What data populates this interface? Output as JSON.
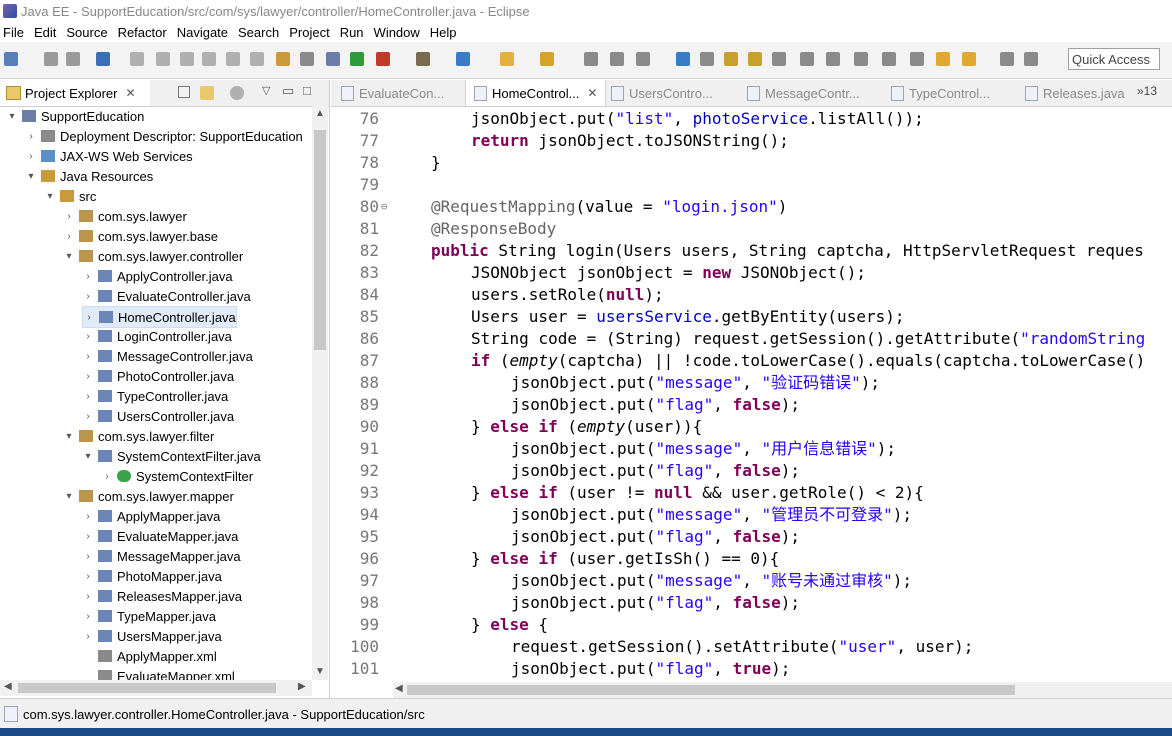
{
  "window": {
    "title": "Java EE - SupportEducation/src/com/sys/lawyer/controller/HomeController.java - Eclipse"
  },
  "menu": [
    "File",
    "Edit",
    "Source",
    "Refactor",
    "Navigate",
    "Search",
    "Project",
    "Run",
    "Window",
    "Help"
  ],
  "toolbar": {
    "quick_access": "Quick Access"
  },
  "project_explorer": {
    "tab_label": "Project Explorer",
    "tree": [
      {
        "label": "SupportEducation",
        "depth": 0,
        "arrow": "▾",
        "icon": "project-icon",
        "color": "#6a7fa8"
      },
      {
        "label": "Deployment Descriptor: SupportEducation",
        "depth": 1,
        "arrow": "›",
        "icon": "descriptor-icon",
        "color": "#8a8a8a"
      },
      {
        "label": "JAX-WS Web Services",
        "depth": 1,
        "arrow": "›",
        "icon": "webservice-icon",
        "color": "#5a8fc8"
      },
      {
        "label": "Java Resources",
        "depth": 1,
        "arrow": "▾",
        "icon": "resources-icon",
        "color": "#c89a3a"
      },
      {
        "label": "src",
        "depth": 2,
        "arrow": "▾",
        "icon": "source-folder-icon",
        "color": "#c89a3a"
      },
      {
        "label": "com.sys.lawyer",
        "depth": 3,
        "arrow": "›",
        "icon": "package-icon",
        "color": "#b9964a"
      },
      {
        "label": "com.sys.lawyer.base",
        "depth": 3,
        "arrow": "›",
        "icon": "package-icon",
        "color": "#b9964a"
      },
      {
        "label": "com.sys.lawyer.controller",
        "depth": 3,
        "arrow": "▾",
        "icon": "package-icon",
        "color": "#b9964a"
      },
      {
        "label": "ApplyController.java",
        "depth": 4,
        "arrow": "›",
        "icon": "java-file-icon",
        "color": "#6a86b8"
      },
      {
        "label": "EvaluateController.java",
        "depth": 4,
        "arrow": "›",
        "icon": "java-file-icon",
        "color": "#6a86b8"
      },
      {
        "label": "HomeController.java",
        "depth": 4,
        "arrow": "›",
        "icon": "java-file-icon",
        "color": "#6a86b8",
        "selected": true
      },
      {
        "label": "LoginController.java",
        "depth": 4,
        "arrow": "›",
        "icon": "java-file-icon",
        "color": "#6a86b8"
      },
      {
        "label": "MessageController.java",
        "depth": 4,
        "arrow": "›",
        "icon": "java-file-icon",
        "color": "#6a86b8"
      },
      {
        "label": "PhotoController.java",
        "depth": 4,
        "arrow": "›",
        "icon": "java-file-icon",
        "color": "#6a86b8"
      },
      {
        "label": "TypeController.java",
        "depth": 4,
        "arrow": "›",
        "icon": "java-file-icon",
        "color": "#6a86b8"
      },
      {
        "label": "UsersController.java",
        "depth": 4,
        "arrow": "›",
        "icon": "java-file-icon",
        "color": "#6a86b8"
      },
      {
        "label": "com.sys.lawyer.filter",
        "depth": 3,
        "arrow": "▾",
        "icon": "package-icon",
        "color": "#b9964a"
      },
      {
        "label": "SystemContextFilter.java",
        "depth": 4,
        "arrow": "▾",
        "icon": "java-file-icon",
        "color": "#6a86b8"
      },
      {
        "label": "SystemContextFilter",
        "depth": 5,
        "arrow": "›",
        "icon": "class-icon",
        "color": "#3aa34a"
      },
      {
        "label": "com.sys.lawyer.mapper",
        "depth": 3,
        "arrow": "▾",
        "icon": "package-icon",
        "color": "#b9964a"
      },
      {
        "label": "ApplyMapper.java",
        "depth": 4,
        "arrow": "›",
        "icon": "java-file-icon",
        "color": "#6a86b8"
      },
      {
        "label": "EvaluateMapper.java",
        "depth": 4,
        "arrow": "›",
        "icon": "java-file-icon",
        "color": "#6a86b8"
      },
      {
        "label": "MessageMapper.java",
        "depth": 4,
        "arrow": "›",
        "icon": "java-file-icon",
        "color": "#6a86b8"
      },
      {
        "label": "PhotoMapper.java",
        "depth": 4,
        "arrow": "›",
        "icon": "java-file-icon",
        "color": "#6a86b8"
      },
      {
        "label": "ReleasesMapper.java",
        "depth": 4,
        "arrow": "›",
        "icon": "java-file-icon",
        "color": "#6a86b8"
      },
      {
        "label": "TypeMapper.java",
        "depth": 4,
        "arrow": "›",
        "icon": "java-file-icon",
        "color": "#6a86b8"
      },
      {
        "label": "UsersMapper.java",
        "depth": 4,
        "arrow": "›",
        "icon": "java-file-icon",
        "color": "#6a86b8"
      },
      {
        "label": "ApplyMapper.xml",
        "depth": 4,
        "arrow": "",
        "icon": "xml-file-icon",
        "color": "#8a8a8a"
      },
      {
        "label": "EvaluateMapper.xml",
        "depth": 4,
        "arrow": "",
        "icon": "xml-file-icon",
        "color": "#8a8a8a"
      }
    ]
  },
  "editor": {
    "tabs": [
      {
        "label": "EvaluateCon...",
        "active": false
      },
      {
        "label": "HomeControl...",
        "active": true
      },
      {
        "label": "UsersContro...",
        "active": false
      },
      {
        "label": "MessageContr...",
        "active": false
      },
      {
        "label": "TypeControl...",
        "active": false
      },
      {
        "label": "Releases.java",
        "active": false
      }
    ],
    "overflow": "»13",
    "lines": [
      {
        "n": "76",
        "indent": 2,
        "html": "jsonObject.put(<s>\"list\"</s>, <f>photoService</f>.listAll());"
      },
      {
        "n": "77",
        "indent": 2,
        "html": "<k>return</k> jsonObject.toJSONString();"
      },
      {
        "n": "78",
        "indent": 1,
        "html": "}"
      },
      {
        "n": "79",
        "indent": 0,
        "html": ""
      },
      {
        "n": "80",
        "indent": 1,
        "fold": true,
        "html": "<a>@RequestMapping</a>(value = <s>\"login.json\"</s>)"
      },
      {
        "n": "81",
        "indent": 1,
        "html": "<a>@ResponseBody</a>"
      },
      {
        "n": "82",
        "indent": 1,
        "html": "<k>public</k> String login(Users users, String captcha, HttpServletRequest reques"
      },
      {
        "n": "83",
        "indent": 2,
        "html": "JSONObject jsonObject = <k>new</k> JSONObject();"
      },
      {
        "n": "84",
        "indent": 2,
        "html": "users.setRole(<k>null</k>);"
      },
      {
        "n": "85",
        "indent": 2,
        "html": "Users user = <f>usersService</f>.getByEntity(users);"
      },
      {
        "n": "86",
        "indent": 2,
        "html": "String code = (String) request.getSession().getAttribute(<s>\"randomString</s>"
      },
      {
        "n": "87",
        "indent": 2,
        "html": "<k>if</k> (<i>empty</i>(captcha) || !code.toLowerCase().equals(captcha.toLowerCase()"
      },
      {
        "n": "88",
        "indent": 3,
        "html": "jsonObject.put(<s>\"message\"</s>, <s>\"验证码错误\"</s>);"
      },
      {
        "n": "89",
        "indent": 3,
        "html": "jsonObject.put(<s>\"flag\"</s>, <k>false</k>);"
      },
      {
        "n": "90",
        "indent": 2,
        "html": "} <k>else</k> <k>if</k> (<i>empty</i>(user)){"
      },
      {
        "n": "91",
        "indent": 3,
        "html": "jsonObject.put(<s>\"message\"</s>, <s>\"用户信息错误\"</s>);"
      },
      {
        "n": "92",
        "indent": 3,
        "html": "jsonObject.put(<s>\"flag\"</s>, <k>false</k>);"
      },
      {
        "n": "93",
        "indent": 2,
        "html": "} <k>else</k> <k>if</k> (user != <k>null</k> && user.getRole() < 2){"
      },
      {
        "n": "94",
        "indent": 3,
        "html": "jsonObject.put(<s>\"message\"</s>, <s>\"管理员不可登录\"</s>);"
      },
      {
        "n": "95",
        "indent": 3,
        "html": "jsonObject.put(<s>\"flag\"</s>, <k>false</k>);"
      },
      {
        "n": "96",
        "indent": 2,
        "html": "} <k>else</k> <k>if</k> (user.getIsSh() == 0){"
      },
      {
        "n": "97",
        "indent": 3,
        "html": "jsonObject.put(<s>\"message\"</s>, <s>\"账号未通过审核\"</s>);"
      },
      {
        "n": "98",
        "indent": 3,
        "html": "jsonObject.put(<s>\"flag\"</s>, <k>false</k>);"
      },
      {
        "n": "99",
        "indent": 2,
        "html": "} <k>else</k> {"
      },
      {
        "n": "100",
        "indent": 3,
        "html": "request.getSession().setAttribute(<s>\"user\"</s>, user);"
      },
      {
        "n": "101",
        "indent": 3,
        "html": "jsonObject.put(<s>\"flag\"</s>, <k>true</k>);"
      }
    ]
  },
  "status_bar": {
    "text": "com.sys.lawyer.controller.HomeController.java - SupportEducation/src"
  }
}
